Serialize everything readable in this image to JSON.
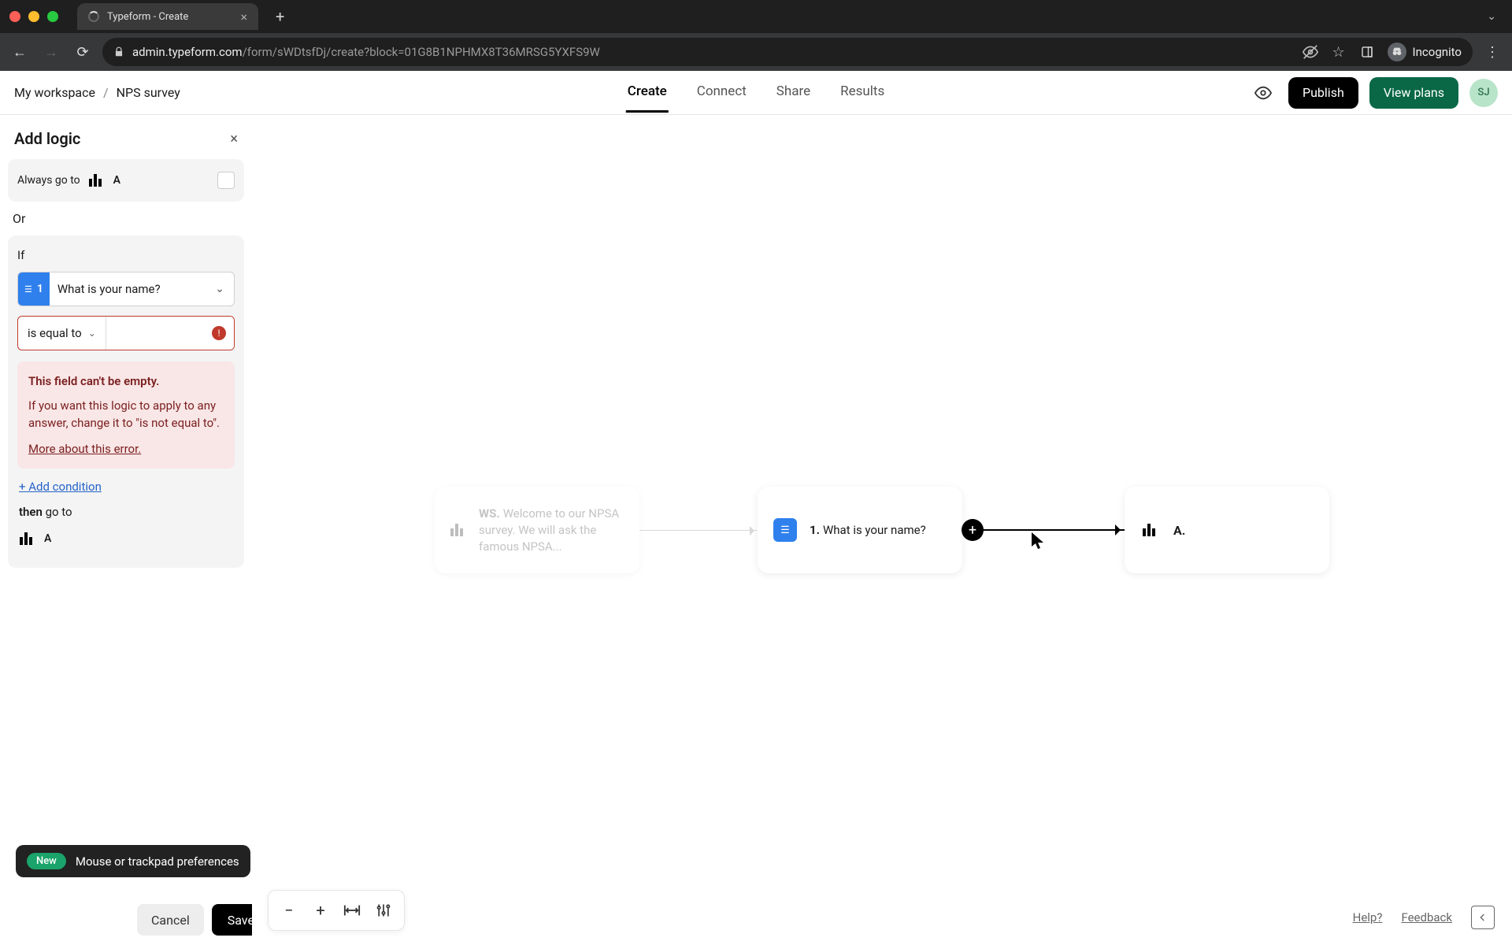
{
  "browser": {
    "tab_title": "Typeform - Create",
    "url_host": "admin.typeform.com",
    "url_path": "/form/sWDtsfDj/create?block=01G8B1NPHMX8T36MRSG5YXFS9W",
    "incognito_label": "Incognito"
  },
  "header": {
    "breadcrumb_workspace": "My workspace",
    "breadcrumb_current": "NPS survey",
    "tabs": {
      "create": "Create",
      "connect": "Connect",
      "share": "Share",
      "results": "Results"
    },
    "publish": "Publish",
    "view_plans": "View plans",
    "avatar_initials": "SJ"
  },
  "sidebar": {
    "title": "Add logic",
    "always_go_to": "Always go to",
    "always_target_label": "A",
    "or_label": "Or",
    "if_label": "If",
    "question_number": "1",
    "question_text": "What is your name?",
    "operator": "is equal to",
    "value": "",
    "error_title": "This field can't be empty.",
    "error_body": "If you want this logic to apply to any answer, change it to \"is not equal to\".",
    "error_link": "More about this error.",
    "add_condition": "+ Add condition",
    "then_label_bold": "then",
    "then_label_rest": " go to",
    "then_target_label": "A",
    "banner_new": "New",
    "banner_text": "Mouse or trackpad preferences",
    "cancel": "Cancel",
    "save": "Save"
  },
  "canvas": {
    "ws_prefix": "WS.",
    "ws_text": "Welcome to our NPSA survey. We will ask the famous NPSA...",
    "q_number": "1.",
    "q_text": "What is your name?",
    "a_label": "A."
  },
  "footer": {
    "help": "Help?",
    "feedback": "Feedback"
  }
}
